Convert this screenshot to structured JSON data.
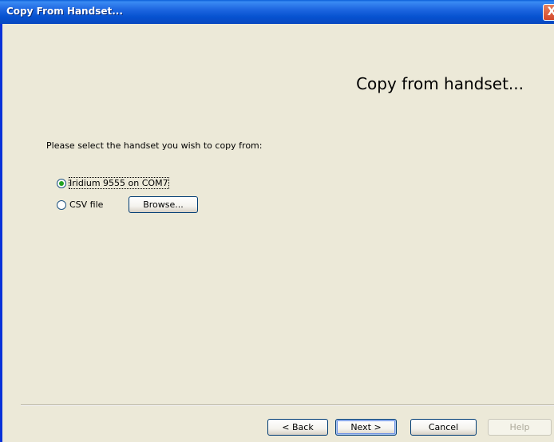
{
  "window": {
    "title": "Copy From Handset...",
    "close_label": "X"
  },
  "wizard": {
    "heading": "Copy from handset...",
    "prompt": "Please select the handset you wish to copy from:",
    "options": [
      {
        "label": "Iridium 9555 on COM7",
        "checked": true
      },
      {
        "label": "CSV file",
        "checked": false
      }
    ],
    "browse_label": "Browse..."
  },
  "footer": {
    "back_label": "< Back",
    "next_label": "Next >",
    "cancel_label": "Cancel",
    "help_label": "Help"
  }
}
